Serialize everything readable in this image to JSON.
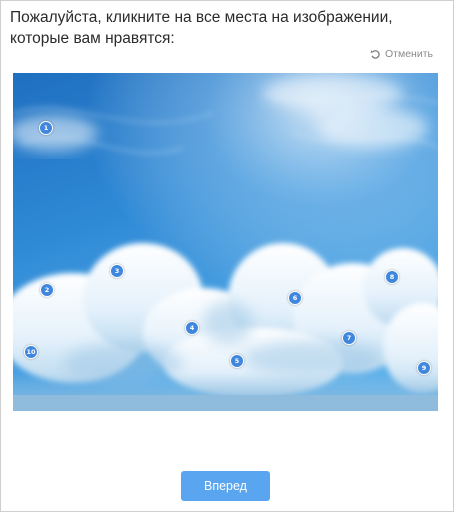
{
  "question": {
    "text": "Пожалуйста, кликните на все места на изображении, которые вам нравятся:"
  },
  "undo": {
    "label": "Отменить",
    "icon": "undo-icon"
  },
  "image": {
    "subject": "sky with clouds painting"
  },
  "markers": [
    {
      "label": "1"
    },
    {
      "label": "2"
    },
    {
      "label": "3"
    },
    {
      "label": "4"
    },
    {
      "label": "5"
    },
    {
      "label": "6"
    },
    {
      "label": "7"
    },
    {
      "label": "8"
    },
    {
      "label": "9"
    },
    {
      "label": "10"
    }
  ],
  "next_button": {
    "label": "Вперед"
  },
  "colors": {
    "accent": "#5aa5ef",
    "marker": "#3f86de"
  }
}
